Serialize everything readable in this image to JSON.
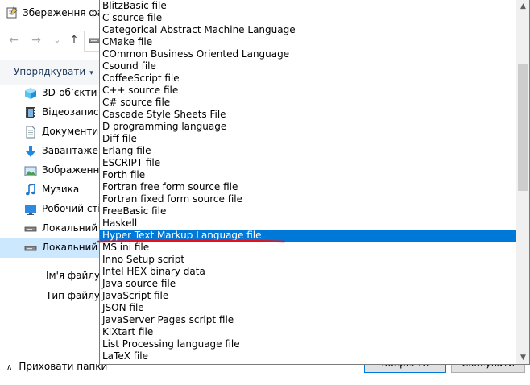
{
  "dialog": {
    "title": "Збереження файлу",
    "nav": {
      "back_icon": "arrow-left-icon",
      "forward_icon": "arrow-right-icon",
      "recent_icon": "chevron-down-icon",
      "up_icon": "arrow-up-icon",
      "back_glyph": "←",
      "forward_glyph": "→",
      "recent_glyph": "⌄",
      "up_glyph": "↑"
    },
    "toolbar": {
      "organize_label": "Упорядкувати",
      "organize_caret": "▾"
    },
    "navpane": {
      "items": [
        {
          "label": "3D-об’єкти",
          "icon": "cube-3d-icon"
        },
        {
          "label": "Відеозаписи",
          "icon": "film-icon"
        },
        {
          "label": "Документи",
          "icon": "document-icon"
        },
        {
          "label": "Завантаження",
          "icon": "download-icon"
        },
        {
          "label": "Зображення",
          "icon": "picture-icon"
        },
        {
          "label": "Музика",
          "icon": "music-icon"
        },
        {
          "label": "Робочий стіл",
          "icon": "desktop-icon"
        },
        {
          "label": "Локальний диск",
          "icon": "drive-icon"
        },
        {
          "label": "Локальний диск",
          "icon": "drive-icon",
          "selected": true
        }
      ]
    },
    "filename_label": "Ім'я файлу:",
    "filetype_label": "Тип файлу:",
    "hide_folders_label": "Приховати папки",
    "hide_folders_glyph": "∧",
    "save_label": "Зберегти",
    "cancel_label": "Скасувати"
  },
  "dropdown": {
    "selected_index": 19,
    "options": [
      "BlitzBasic file",
      "C source file",
      "Categorical Abstract Machine Language",
      "CMake file",
      "COmmon Business Oriented Language",
      "Csound file",
      "CoffeeScript file",
      "C++ source file",
      "C# source file",
      "Cascade Style Sheets File",
      "D programming language",
      "Diff file",
      "Erlang file",
      "ESCRIPT file",
      "Forth file",
      "Fortran free form source file",
      "Fortran fixed form source file",
      "FreeBasic file",
      "Haskell",
      "Hyper Text Markup Language file",
      "MS ini file",
      "Inno Setup script",
      "Intel HEX binary data",
      "Java source file",
      "JavaScript file",
      "JSON file",
      "JavaServer Pages script file",
      "KiXtart file",
      "List Processing language file",
      "LaTeX file"
    ],
    "scroll_up_glyph": "▲",
    "scroll_down_glyph": "▼"
  },
  "colors": {
    "selection": "#0078d7",
    "annotation": "#e8101c",
    "nav_selected": "#cce8ff"
  }
}
